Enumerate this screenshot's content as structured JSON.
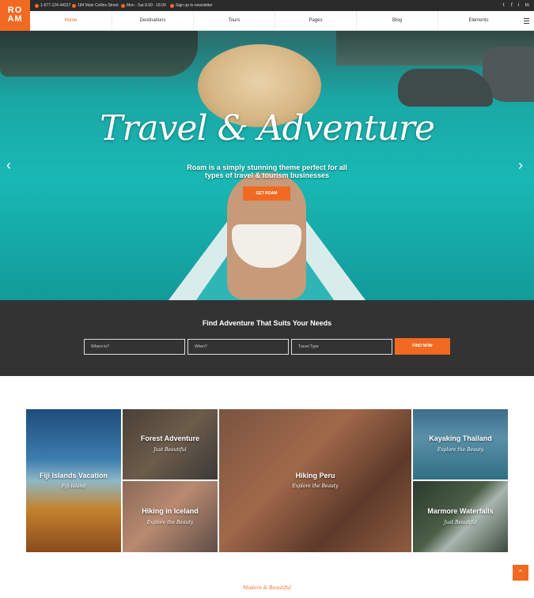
{
  "brand": {
    "logo_line1": "RO",
    "logo_line2": "AM",
    "accent": "#f26a21"
  },
  "topbar": {
    "phone": "1-677-124-44227",
    "address": "184 Main Collins Street",
    "hours": "Mon - Sat 8.00 - 18.00",
    "newsletter": "Sign up to newsletter",
    "social": [
      "t",
      "f",
      "i",
      "in"
    ]
  },
  "nav": {
    "items": [
      "Home",
      "Destinations",
      "Tours",
      "Pages",
      "Blog",
      "Elements"
    ]
  },
  "hero": {
    "title": "Travel & Adventure",
    "subtitle": "Roam is a simply stunning theme perfect for all types of travel & tourism businesses",
    "button": "GET ROAM",
    "prev": "‹",
    "next": "›"
  },
  "search": {
    "title": "Find Adventure That Suits Your Needs",
    "where_placeholder": "Where to?",
    "when_placeholder": "When?",
    "type_placeholder": "Travel Type",
    "button": "FIND NOW"
  },
  "tiles": [
    {
      "title": "Fiji Islands Vacation",
      "sub": "Fiji Island"
    },
    {
      "title": "Forest Adventure",
      "sub": "Just Beautiful"
    },
    {
      "title": "Hiking in Iceland",
      "sub": "Explore the Beauty"
    },
    {
      "title": "Hiking Peru",
      "sub": "Explore the Beauty"
    },
    {
      "title": "Kayaking Thailand",
      "sub": "Explore the Beauty"
    },
    {
      "title": "Marmore Waterfalls",
      "sub": "Just Beautiful"
    }
  ],
  "tagline": "Modern & Beautiful",
  "back_to_top": "^"
}
